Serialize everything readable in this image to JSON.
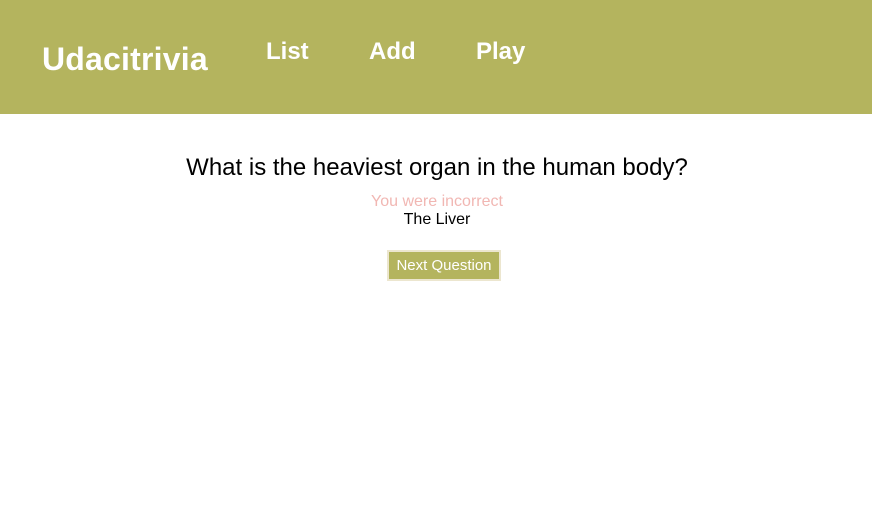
{
  "header": {
    "brand": "Udacitrivia",
    "nav": {
      "list_label": "List",
      "add_label": "Add",
      "play_label": "Play"
    }
  },
  "game": {
    "question": "What is the heaviest organ in the human body?",
    "result": "You were incorrect",
    "answer": "The Liver",
    "next_label": "Next Question"
  },
  "colors": {
    "header_bg": "#b4b45e",
    "accent": "#b4b45e",
    "incorrect_text": "#f1b7b3"
  }
}
